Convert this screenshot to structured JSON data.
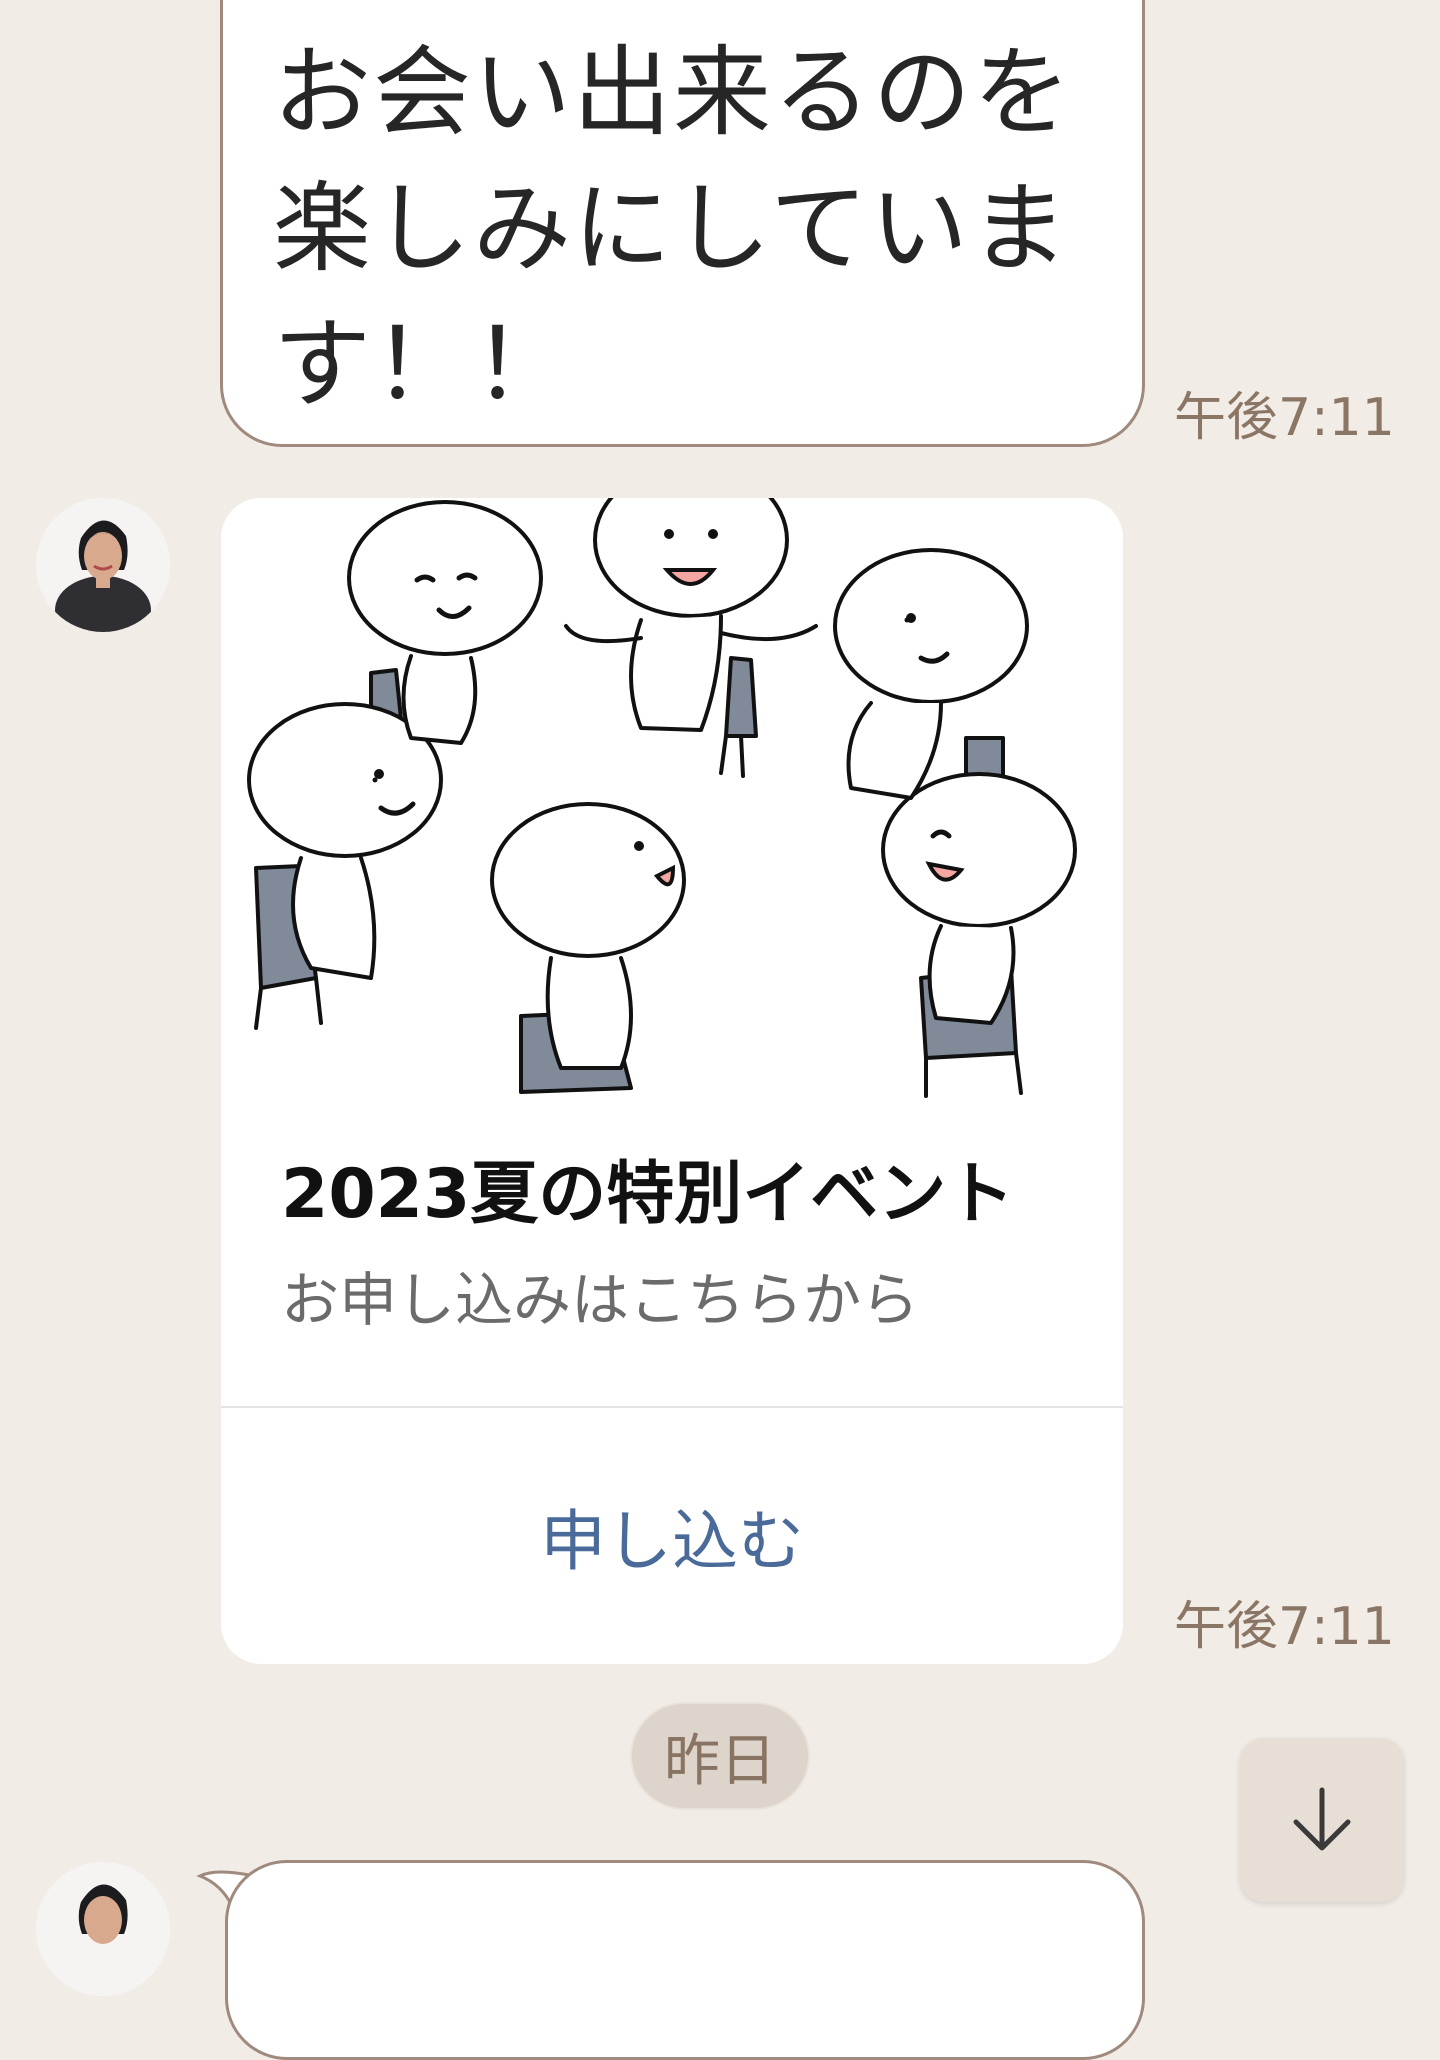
{
  "messages": [
    {
      "text": "お会い出来るのを楽しみにしています！！",
      "time": "午後7:11"
    },
    {
      "card": {
        "title": "2023夏の特別イベント",
        "subtitle": "お申し込みはこちらから",
        "action_label": "申し込む"
      },
      "time": "午後7:11"
    }
  ],
  "date_separator": "昨日",
  "colors": {
    "background": "#f1ece6",
    "bubble_border": "#a08a7d",
    "timestamp": "#8b7565",
    "link": "#4a6b9a"
  },
  "icons": {
    "scroll_down": "arrow-down-icon"
  }
}
